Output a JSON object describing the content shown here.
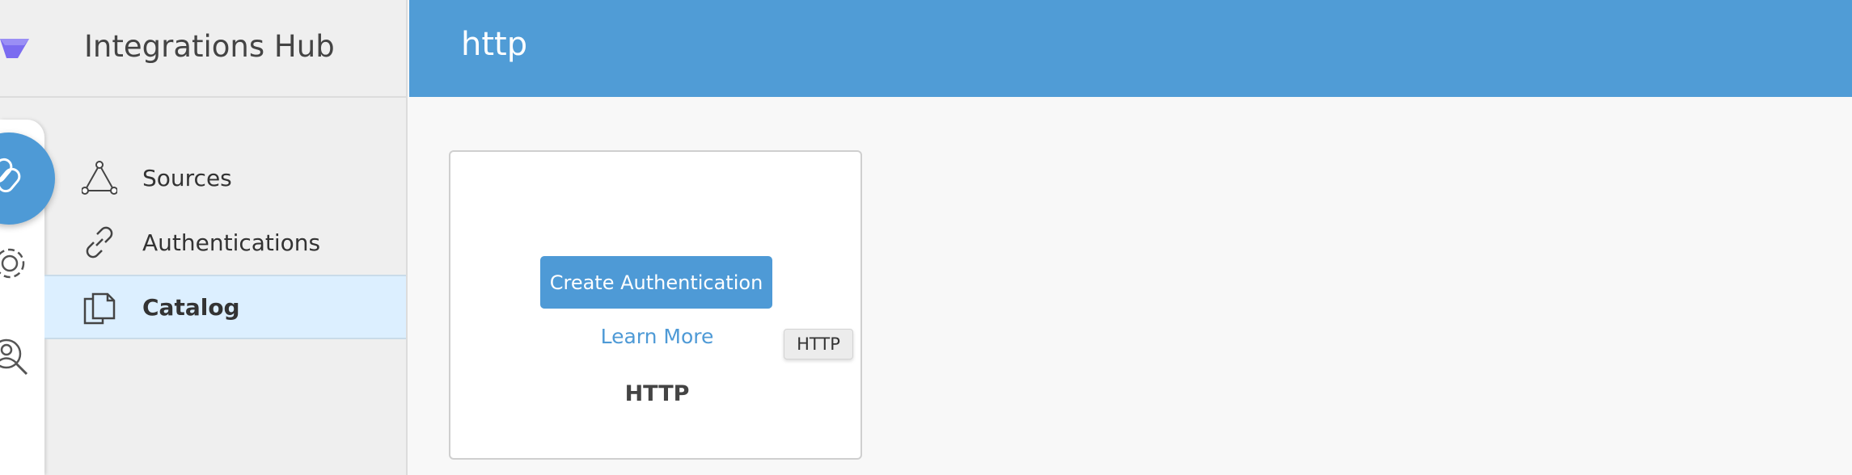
{
  "sidebar": {
    "title": "Integrations Hub",
    "items": [
      {
        "label": "Sources",
        "icon": "triangle-nodes-icon"
      },
      {
        "label": "Authentications",
        "icon": "link-icon"
      },
      {
        "label": "Catalog",
        "icon": "copy-documents-icon",
        "active": true
      }
    ]
  },
  "rail": {
    "icons": [
      "link-icon",
      "gear-refresh-icon",
      "search-user-icon"
    ]
  },
  "header": {
    "title": "http"
  },
  "card": {
    "create_label": "Create Authentication",
    "learn_more_label": "Learn More",
    "name": "HTTP"
  },
  "tooltip": {
    "text": "HTTP"
  },
  "colors": {
    "accent": "#509cd6",
    "active_bg": "#dcefff",
    "sidebar_bg": "#efefef",
    "logo": "#7b6cf0"
  }
}
